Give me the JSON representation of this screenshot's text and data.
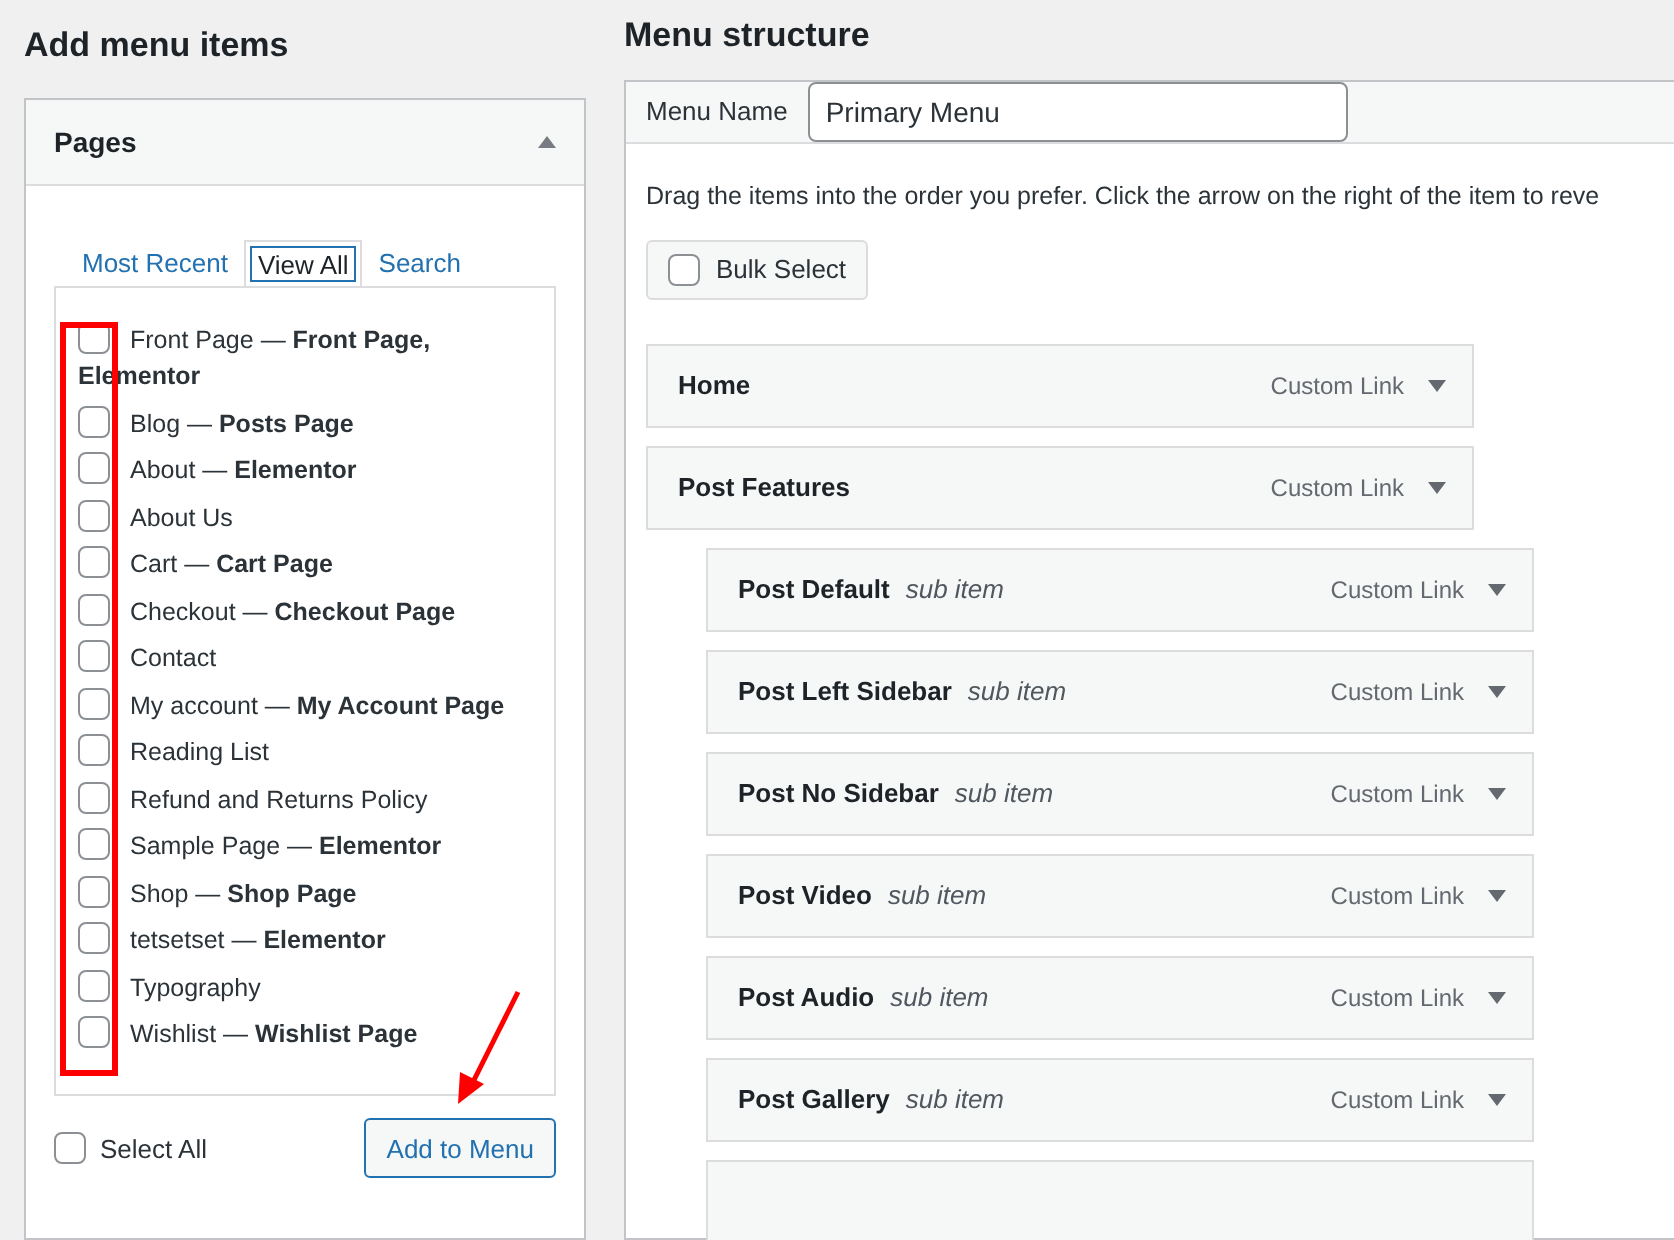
{
  "left_title": "Add menu items",
  "pages_panel": {
    "title": "Pages",
    "expanded": true,
    "tabs": [
      {
        "label": "Most Recent",
        "selected": false
      },
      {
        "label": "View All",
        "selected": true
      },
      {
        "label": "Search",
        "selected": false
      }
    ],
    "items": [
      {
        "label": "Front Page — **Front Page, Elementor**",
        "checked": false
      },
      {
        "label": "Blog — **Posts Page**",
        "checked": false
      },
      {
        "label": "About — **Elementor**",
        "checked": false
      },
      {
        "label": "About Us",
        "checked": false
      },
      {
        "label": "Cart — **Cart Page**",
        "checked": false
      },
      {
        "label": "Checkout — **Checkout Page**",
        "checked": false
      },
      {
        "label": "Contact",
        "checked": false
      },
      {
        "label": "My account — **My Account Page**",
        "checked": false
      },
      {
        "label": "Reading List",
        "checked": false
      },
      {
        "label": "Refund and Returns Policy",
        "checked": false
      },
      {
        "label": "Sample Page — **Elementor**",
        "checked": false
      },
      {
        "label": "Shop — **Shop Page**",
        "checked": false
      },
      {
        "label": "tetsetset — **Elementor**",
        "checked": false
      },
      {
        "label": "Typography",
        "checked": false
      },
      {
        "label": "Wishlist — **Wishlist Page**",
        "checked": false
      }
    ],
    "select_all": {
      "label": "Select All",
      "checked": false
    },
    "add_button": "Add to Menu"
  },
  "right_title": "Menu structure",
  "menu_name": {
    "label": "Menu Name",
    "value": "Primary Menu"
  },
  "instructions": "Drag the items into the order you prefer. Click the arrow on the right of the item to reve",
  "bulk_select": {
    "label": "Bulk Select",
    "checked": false
  },
  "menu_items": [
    {
      "title": "Home",
      "type": "Custom Link"
    },
    {
      "title": "Post Features",
      "type": "Custom Link",
      "children": [
        {
          "title": "Post Default",
          "note": "sub item",
          "type": "Custom Link"
        },
        {
          "title": "Post Left Sidebar",
          "note": "sub item",
          "type": "Custom Link"
        },
        {
          "title": "Post No Sidebar",
          "note": "sub item",
          "type": "Custom Link"
        },
        {
          "title": "Post Video",
          "note": "sub item",
          "type": "Custom Link"
        },
        {
          "title": "Post Audio",
          "note": "sub item",
          "type": "Custom Link"
        },
        {
          "title": "Post Gallery",
          "note": "sub item",
          "type": "Custom Link"
        }
      ]
    }
  ]
}
